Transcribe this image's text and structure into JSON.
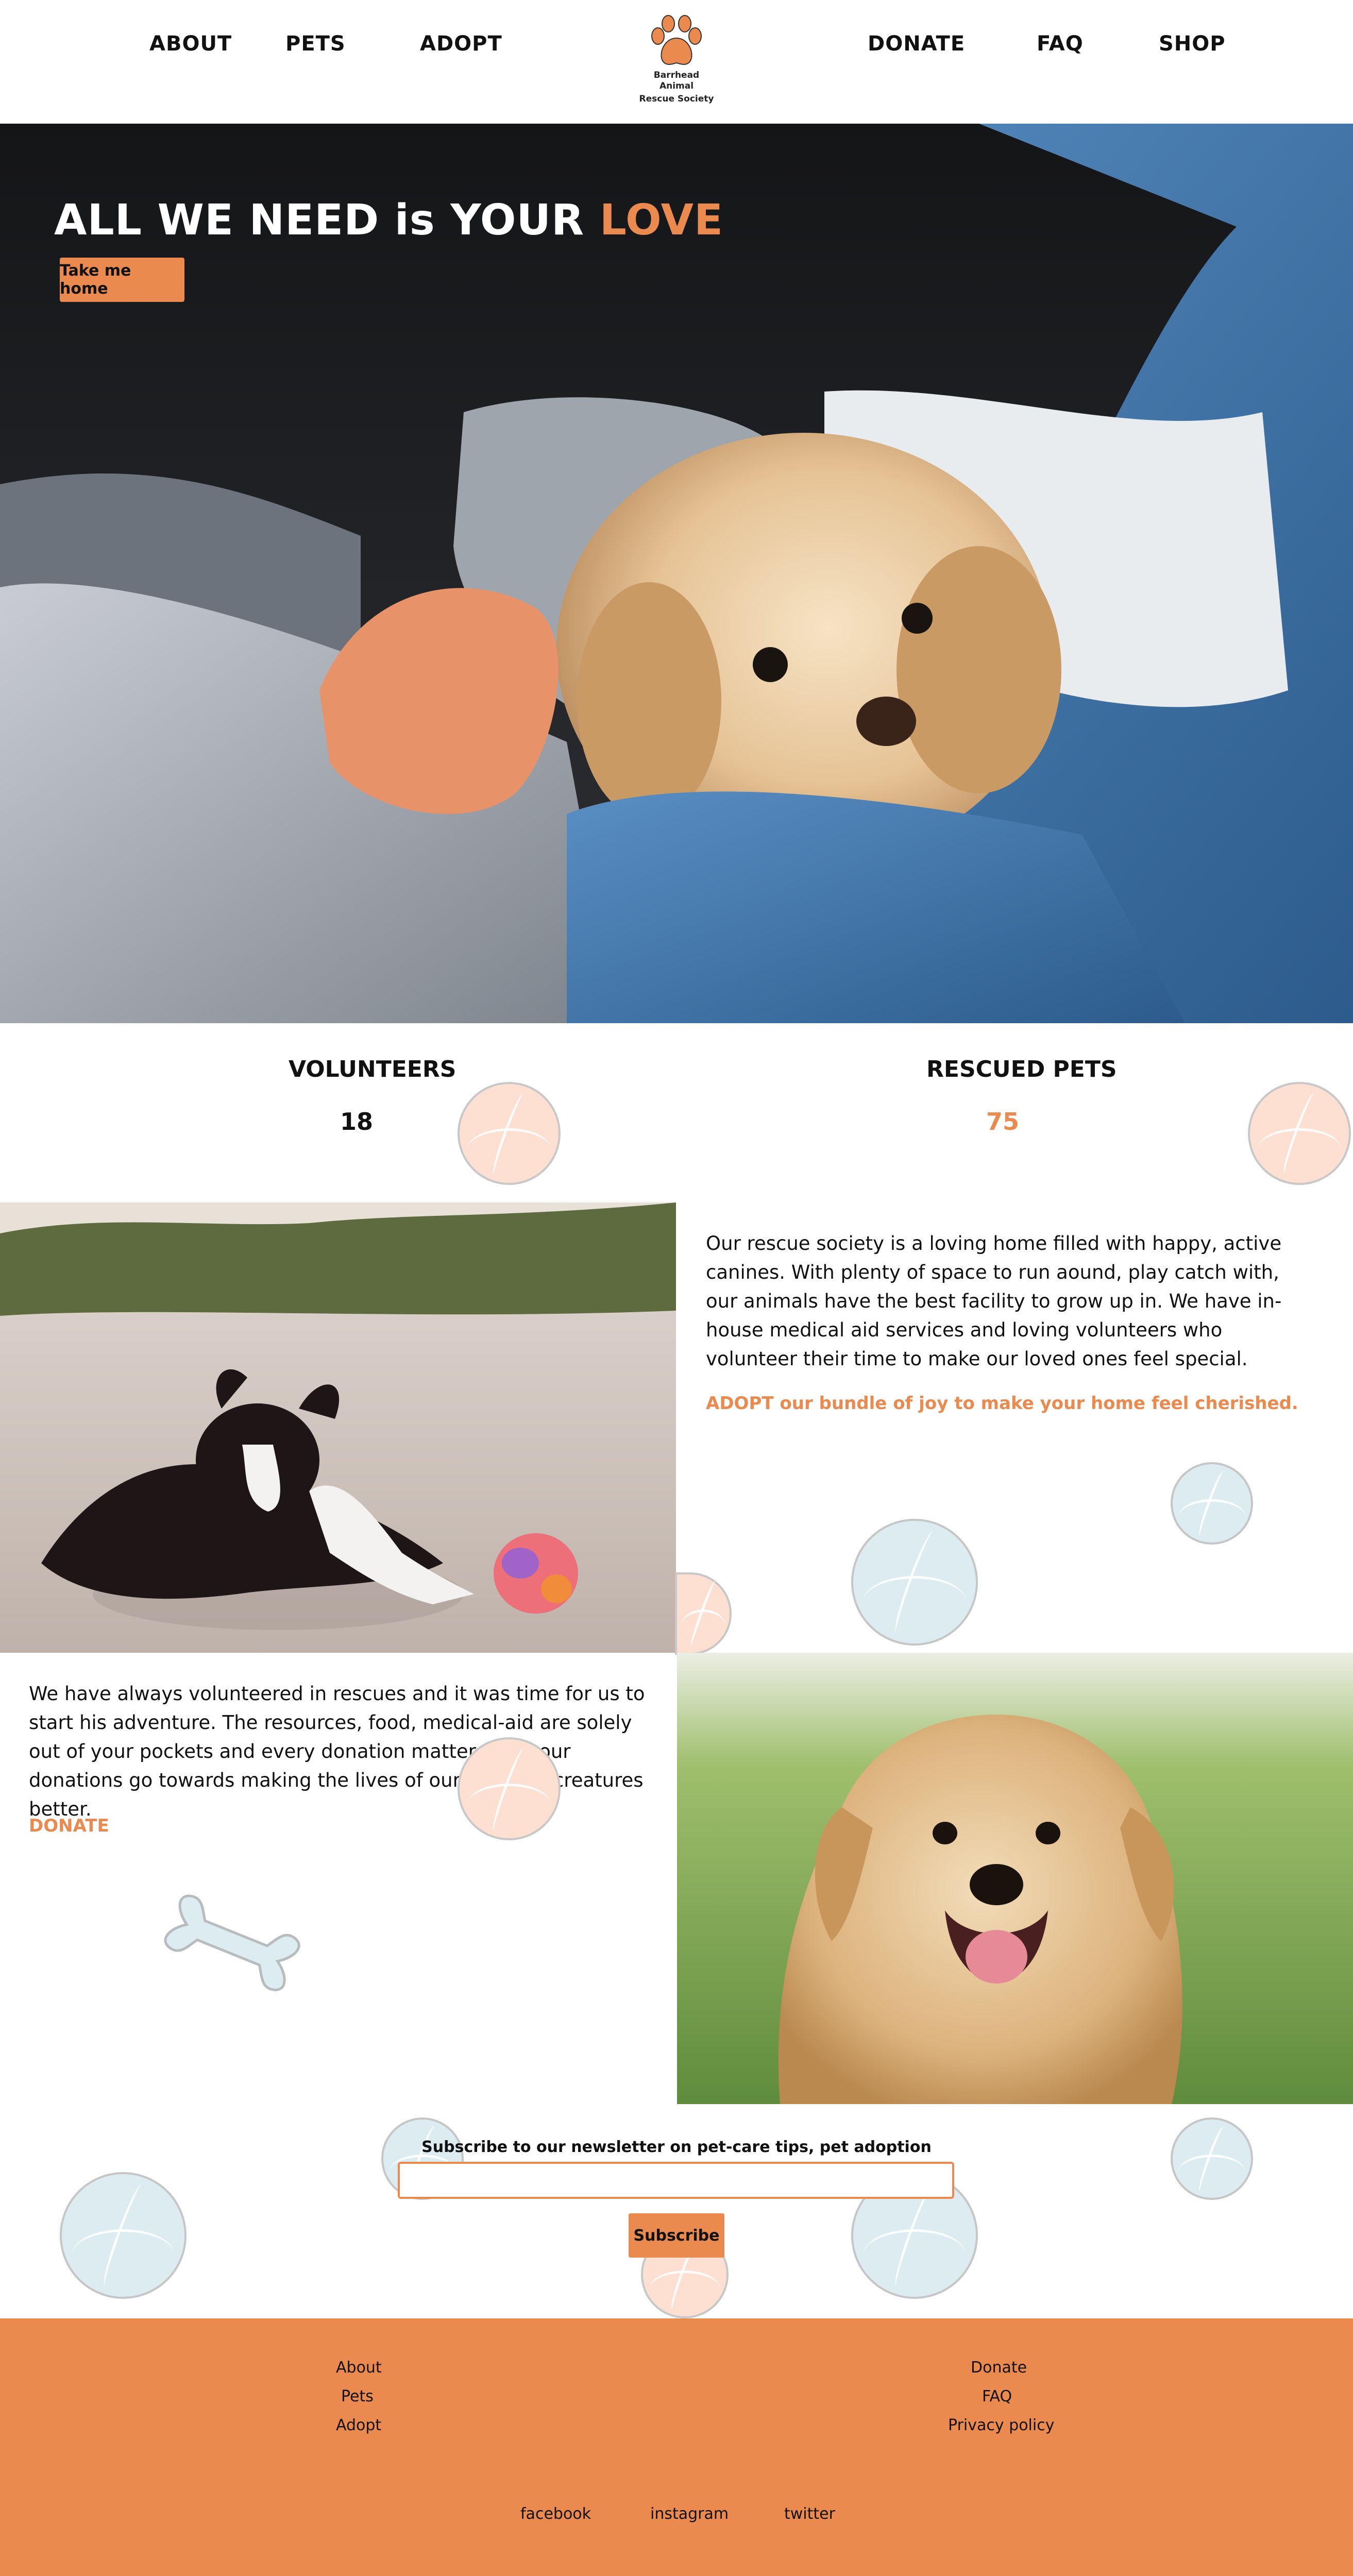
{
  "nav": {
    "left": [
      "ABOUT",
      "PETS",
      "ADOPT"
    ],
    "right": [
      "DONATE",
      "FAQ",
      "SHOP"
    ],
    "logo_line1": "Barrhead Animal",
    "logo_line2": "Rescue Society"
  },
  "hero": {
    "title_main": "ALL WE NEED is YOUR ",
    "title_accent": "LOVE",
    "button": "Take me home"
  },
  "stats": {
    "volunteers_label": "VOLUNTEERS",
    "volunteers_value": "18",
    "rescued_label": "RESCUED PETS",
    "rescued_value": "75"
  },
  "about": {
    "text": "Our rescue society is a loving home filled with happy, active canines. With plenty of space to run aound, play catch with, our animals have the best facility to grow up in. We have in-house medical aid services and loving volunteers who volunteer their time to make our loved ones feel special.",
    "cta": "ADOPT our bundle of joy to make your home feel cherished."
  },
  "donate": {
    "text": "We have always volunteered in rescues and it was time for us to start his adventure. The resources, food, medical-aid are solely out of your pockets and every donation matters. All your donations go towards making the lives of our precious creatures better.",
    "cta": "DONATE"
  },
  "newsletter": {
    "label": "Subscribe to our newsletter on pet-care tips, pet adoption",
    "input_value": "",
    "button": "Subscribe"
  },
  "footer": {
    "col1": [
      "About",
      "Pets",
      "Adopt"
    ],
    "col2": [
      "Donate",
      "FAQ",
      "Privacy policy"
    ],
    "social": [
      "facebook",
      "instagram",
      "twitter"
    ]
  },
  "colors": {
    "accent": "#ea8a4e",
    "ball_peach": "#fde0d2",
    "ball_blue": "#dcecf1"
  }
}
